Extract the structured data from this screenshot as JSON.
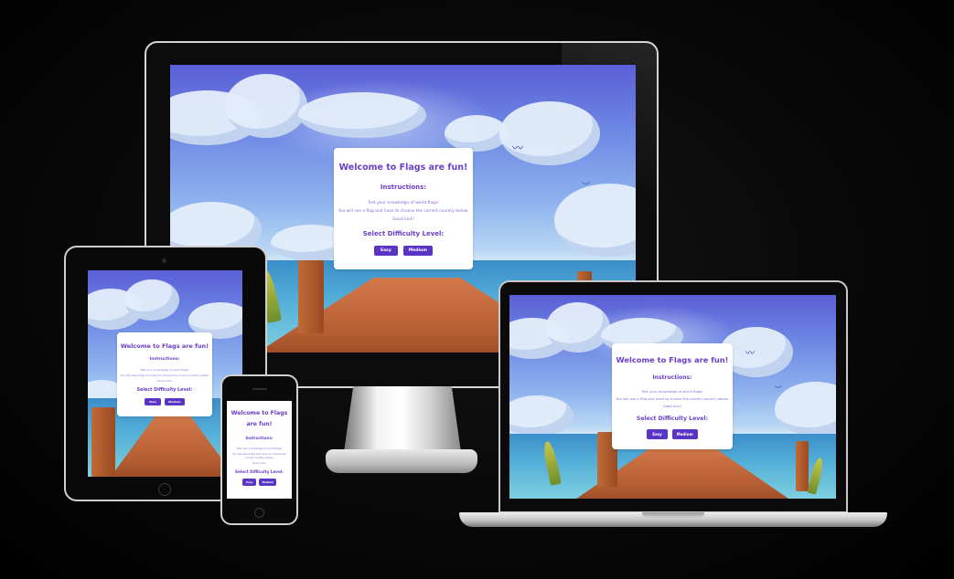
{
  "app": {
    "title": "Welcome to Flags are fun!",
    "instructions_heading": "Instructions:",
    "instructions_line1": "Test your knowledge of world flags!",
    "instructions_line2": "You will see a flag and have to choose the correct country below.",
    "instructions_line3": "Good luck!",
    "difficulty_heading": "Select Difficulty Level:",
    "easy_label": "Easy",
    "medium_label": "Medium"
  },
  "theme": {
    "accent": "#5a34c4",
    "text": "#6b3ec9",
    "background": "#000000"
  },
  "devices": [
    "desktop-monitor",
    "tablet",
    "phone",
    "laptop"
  ]
}
